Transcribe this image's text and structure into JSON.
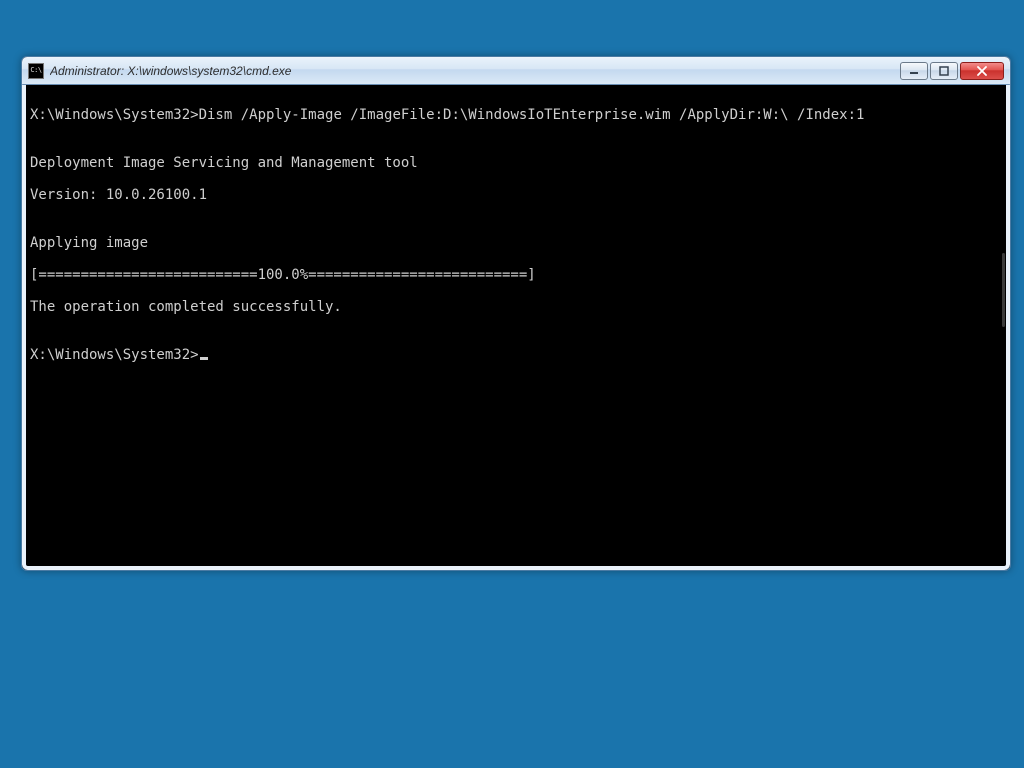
{
  "window": {
    "title": "Administrator: X:\\windows\\system32\\cmd.exe",
    "icon_label": "C:\\"
  },
  "controls": {
    "minimize_label": "Minimize",
    "maximize_label": "Maximize",
    "close_label": "Close"
  },
  "console": {
    "prompt": "X:\\Windows\\System32>",
    "command": "Dism /Apply-Image /ImageFile:D:\\WindowsIoTEnterprise.wim /ApplyDir:W:\\ /Index:1",
    "lines": [
      "",
      "Deployment Image Servicing and Management tool",
      "Version: 10.0.26100.1",
      "",
      "Applying image",
      "[==========================100.0%==========================]",
      "The operation completed successfully."
    ],
    "final_prompt": "X:\\Windows\\System32>"
  }
}
